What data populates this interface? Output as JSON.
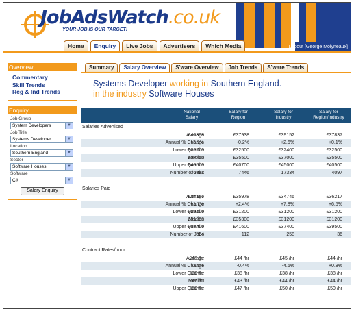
{
  "brand": {
    "logo": "JobAdsWatch",
    "logo_tld": ".co.uk",
    "tagline": "YOUR JOB IS OUR TARGET!",
    "accent": "#f29a1c",
    "navy": "#1b3a8a"
  },
  "header": {
    "logout": "Logout [George Molyneaux]",
    "nav": [
      "Home",
      "Enquiry",
      "Live Jobs",
      "Advertisers",
      "Which Media"
    ],
    "active_nav": "Enquiry"
  },
  "sidebar": {
    "overview_title": "Overview",
    "links": [
      "Commentary",
      "Skill Trends",
      "Reg & Ind Trends"
    ],
    "enquiry_title": "Enquiry",
    "fields": [
      {
        "label": "Job Group",
        "value": "System Developers"
      },
      {
        "label": "Job Title",
        "value": "Systems Developer"
      },
      {
        "label": "Location",
        "value": "Southern England"
      },
      {
        "label": "Sector",
        "value": "Software Houses"
      },
      {
        "label": "Software",
        "value": "C#"
      }
    ],
    "button": "Salary Enquiry"
  },
  "main": {
    "tabs": [
      "Summary",
      "Salary Overview",
      "S'ware Overview",
      "Job Trends",
      "S'ware Trends"
    ],
    "active_tab": "Salary Overview",
    "heading": {
      "p1": "Systems Developer",
      "p2": " working in ",
      "p3": "Southern England",
      "p4": ".",
      "p5": "in the industry",
      "p6": " Software Houses"
    },
    "columns": [
      {
        "l1": "National",
        "l2": "Salary"
      },
      {
        "l1": "Salary for",
        "l2": "Region"
      },
      {
        "l1": "Salary for",
        "l2": "Industry"
      },
      {
        "l1": "Salary for",
        "l2": "Region/Industry"
      }
    ],
    "sections": [
      {
        "title": "Salaries Advertised",
        "rows": [
          {
            "label": "Average",
            "v": [
              "£40898",
              "£37938",
              "£39152",
              "£37837"
            ]
          },
          {
            "label": "Annual % Change",
            "v": [
              "+3.9%",
              "-0.2%",
              "+2.6%",
              "+0.1%"
            ]
          },
          {
            "label": "Lower Quartile",
            "v": [
              "£32700",
              "£32500",
              "£32400",
              "£32500"
            ]
          },
          {
            "label": "Median",
            "v": [
              "£37700",
              "£35500",
              "£37000",
              "£35500"
            ]
          },
          {
            "label": "Upper Quartile",
            "v": [
              "£46500",
              "£40700",
              "£45000",
              "£40500"
            ]
          },
          {
            "label": "Number of Jobs",
            "v": [
              "36332",
              "7446",
              "17334",
              "4097"
            ]
          }
        ]
      },
      {
        "title": "Salaries Paid",
        "rows": [
          {
            "label": "Average",
            "v": [
              "£34187",
              "£35978",
              "£34746",
              "£36217"
            ]
          },
          {
            "label": "Annual % Change",
            "v": [
              "+1.7%",
              "+2.4%",
              "+7.8%",
              "+6.5%"
            ]
          },
          {
            "label": "Lower Quartile",
            "v": [
              "£29100",
              "£31200",
              "£31200",
              "£31200"
            ]
          },
          {
            "label": "Median",
            "v": [
              "£31200",
              "£35300",
              "£31200",
              "£31200"
            ]
          },
          {
            "label": "Upper Quartile",
            "v": [
              "£37400",
              "£41600",
              "£37400",
              "£39500"
            ]
          },
          {
            "label": "Number of Jobs",
            "v": [
              "804",
              "112",
              "258",
              "36"
            ]
          }
        ]
      },
      {
        "title": "Contract Rates/hour",
        "rows": [
          {
            "label": "Average",
            "v": [
              "£48 /hr",
              "£44 /hr",
              "£45 /hr",
              "£44 /hr"
            ]
          },
          {
            "label": "Annual % Change",
            "v": [
              "-2.5%",
              "-0.4%",
              "-4.6%",
              "+0.8%"
            ]
          },
          {
            "label": "Lower Quartile",
            "v": [
              "£38 /hr",
              "£38 /hr",
              "£38 /hr",
              "£38 /hr"
            ]
          },
          {
            "label": "Median",
            "v": [
              "£45 /hr",
              "£43 /hr",
              "£44 /hr",
              "£44 /hr"
            ]
          },
          {
            "label": "Upper Quartile",
            "v": [
              "£58 /hr",
              "£47 /hr",
              "£50 /hr",
              "£50 /hr"
            ]
          }
        ]
      }
    ]
  }
}
